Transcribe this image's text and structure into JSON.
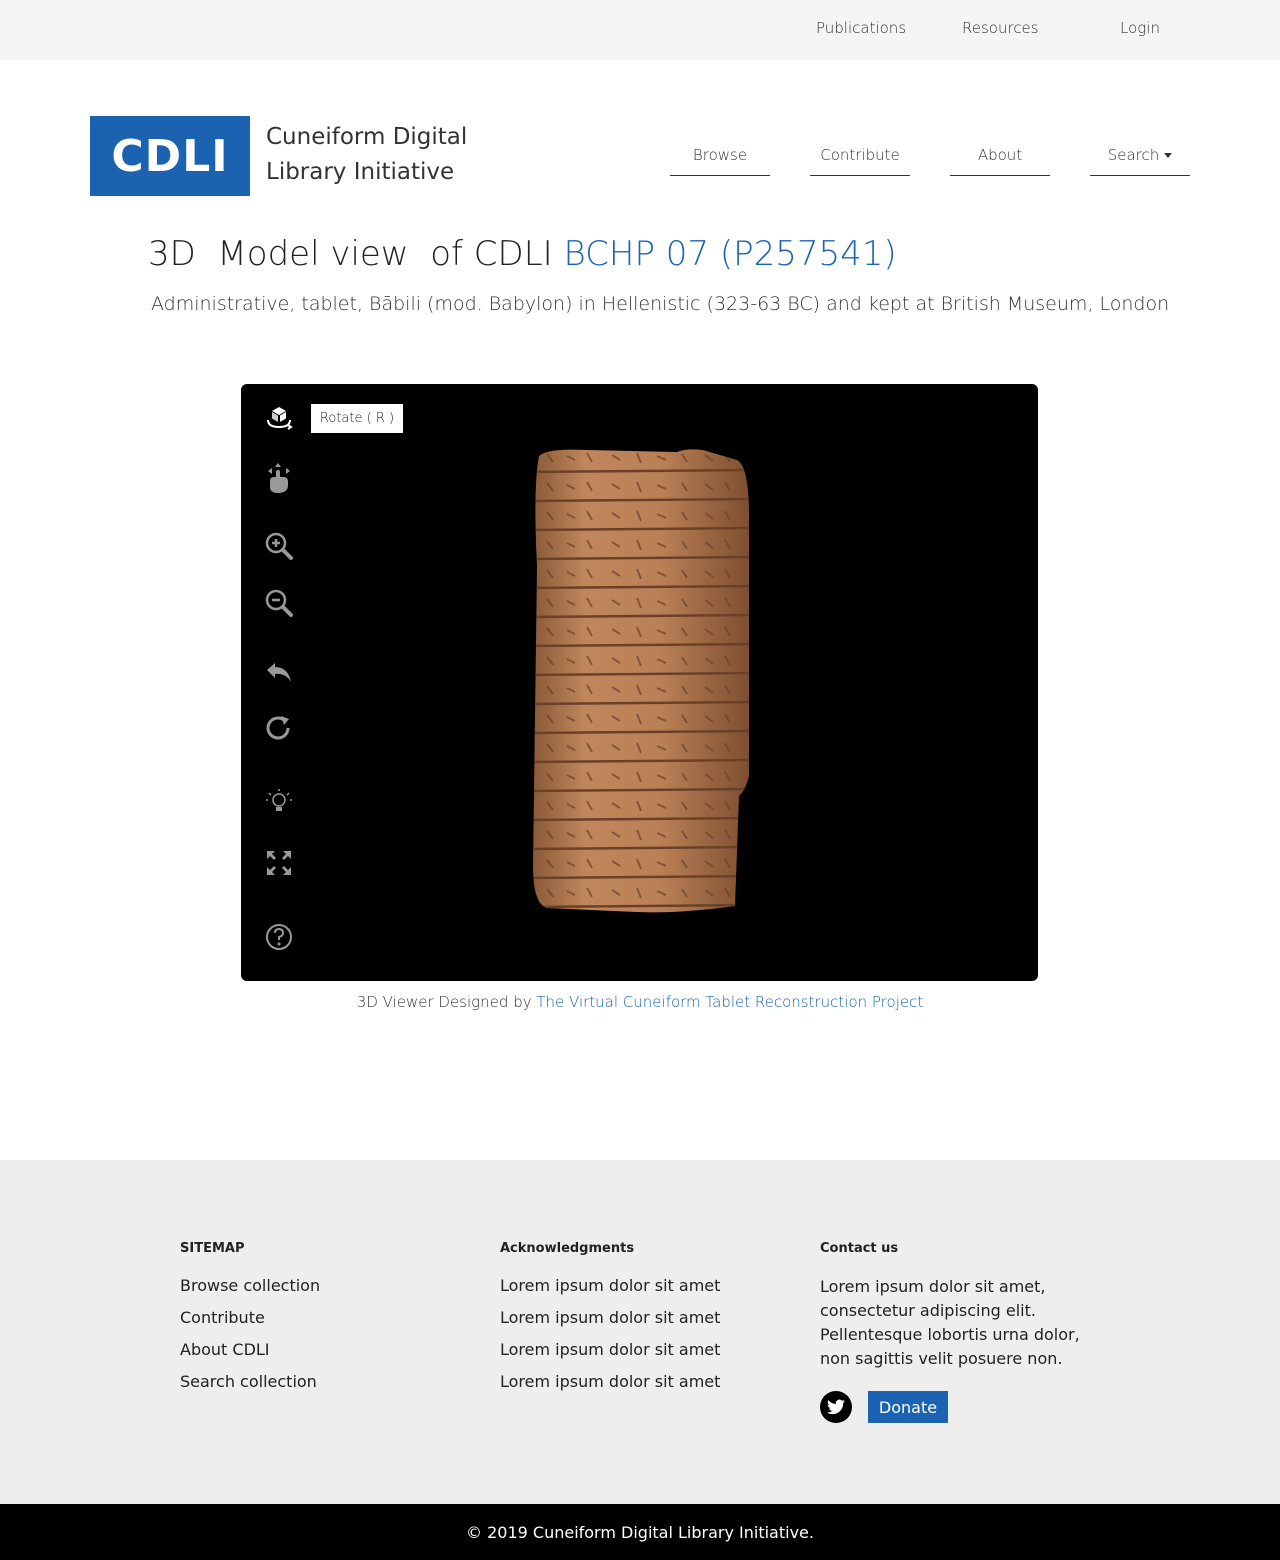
{
  "topbar": {
    "items": [
      "Publications",
      "Resources",
      "Login"
    ]
  },
  "header": {
    "logo": "CDLI",
    "site_name": "Cuneiform Digital Library Initiative",
    "nav": [
      "Browse",
      "Contribute",
      "About",
      "Search"
    ]
  },
  "title": {
    "prefix": "3D  Model view  of CDLI ",
    "link": "BCHP 07 (P257541)",
    "subtitle": "Administrative, tablet, Bābili (mod. Babylon) in Hellenistic (323-63 BC) and kept at British Museum, London"
  },
  "viewer": {
    "tooltip": "Rotate ( R )",
    "tools": [
      "rotate-icon",
      "pan-icon",
      "zoom-in-icon",
      "zoom-out-icon",
      "undo-icon",
      "reset-icon",
      "light-icon",
      "fullscreen-icon",
      "help-icon"
    ],
    "credit_prefix": "3D Viewer Designed by ",
    "credit_link": "The Virtual Cuneiform Tablet Reconstruction Project"
  },
  "footer": {
    "sitemap": {
      "heading": "SITEMAP",
      "items": [
        "Browse collection",
        "Contribute",
        "About CDLI",
        "Search collection"
      ]
    },
    "acknowledgments": {
      "heading": "Acknowledgments",
      "items": [
        "Lorem ipsum dolor sit amet",
        "Lorem ipsum dolor sit amet",
        "Lorem ipsum dolor sit amet",
        "Lorem ipsum dolor sit amet"
      ]
    },
    "contact": {
      "heading": "Contact us",
      "text": "Lorem ipsum dolor sit amet, consectetur adipiscing elit. Pellentesque lobortis urna dolor, non sagittis velit posuere non.",
      "donate_label": "Donate"
    },
    "copyright": "© 2019 Cuneiform Digital Library Initiative."
  },
  "colors": {
    "brand": "#1b63b0",
    "footer_bg": "#eeeeee",
    "viewer_bg": "#000000"
  }
}
